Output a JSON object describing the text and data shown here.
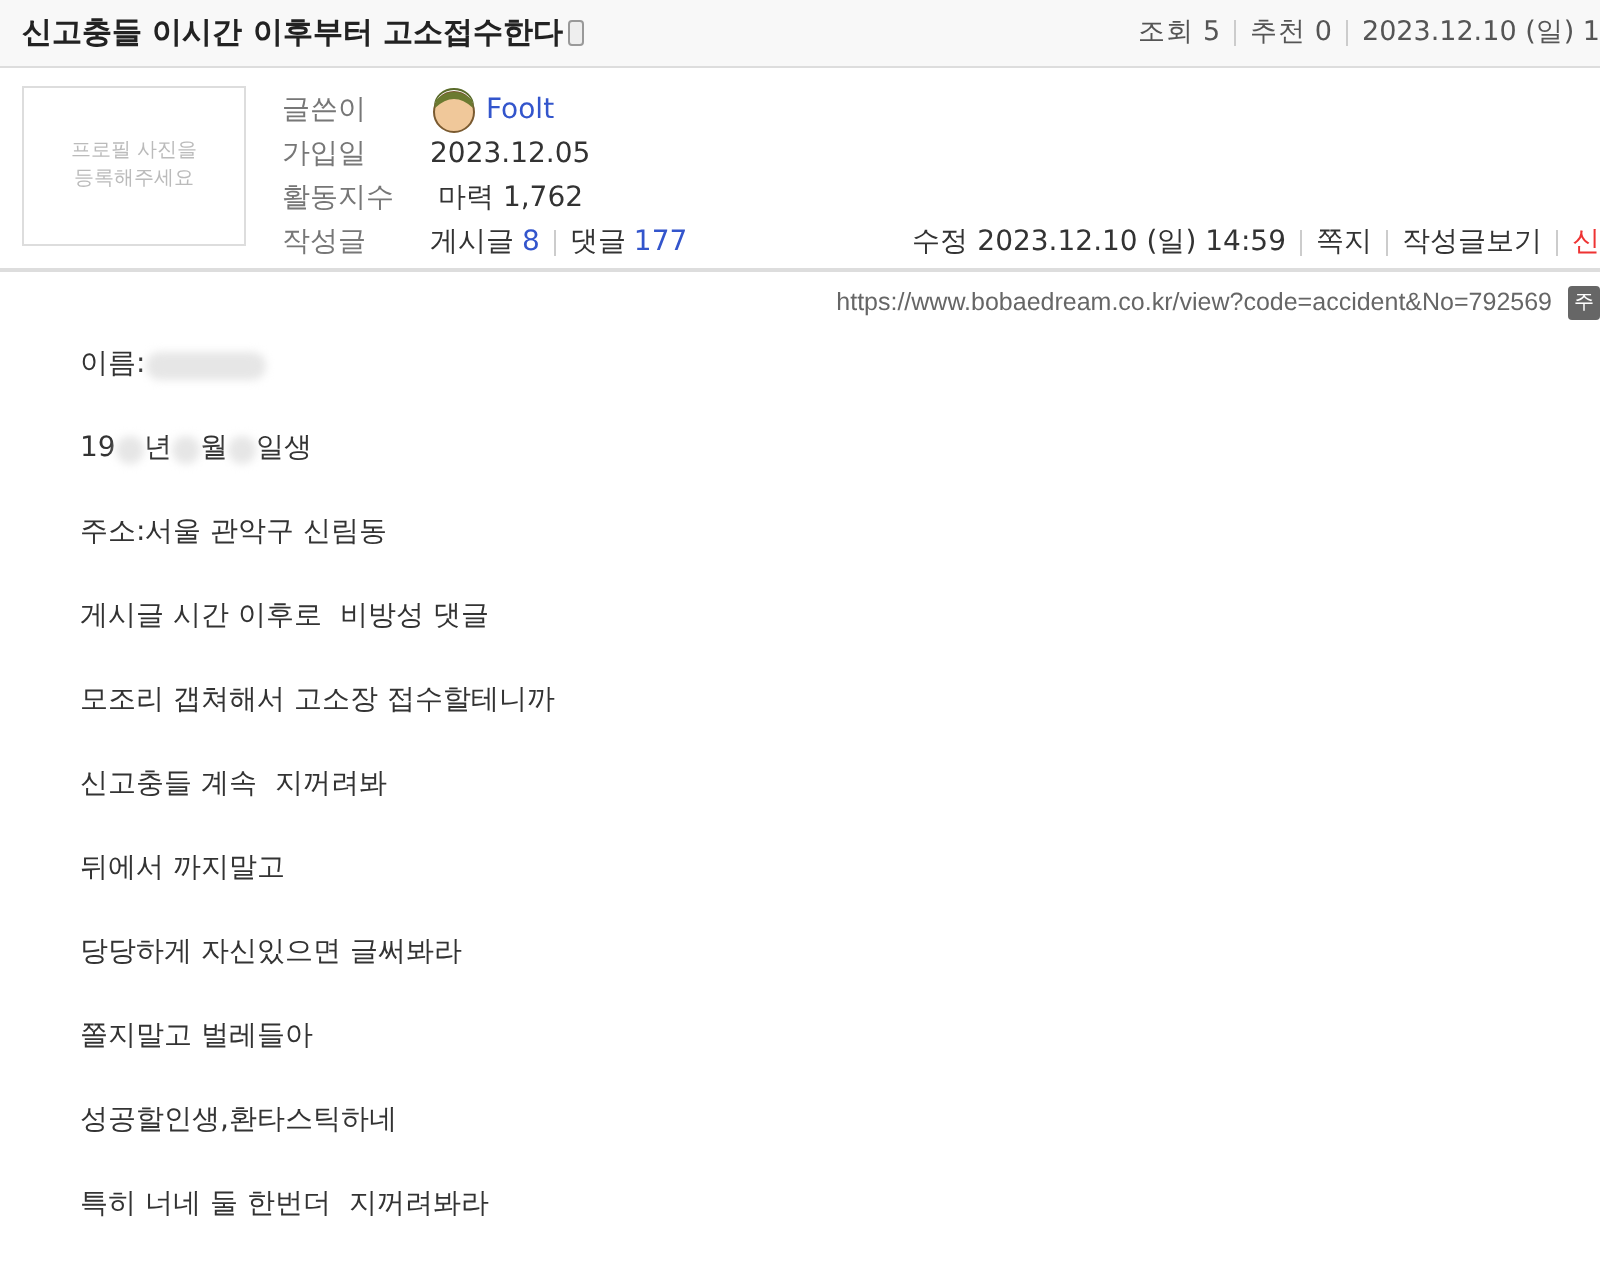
{
  "post": {
    "title": "신고충들 이시간 이후부터 고소접수한다",
    "stats": [
      "조회 5",
      "추천 0",
      "2023.12.10 (일) 1"
    ]
  },
  "profile": {
    "photo_placeholder": "프로필 사진을\n등록해주세요"
  },
  "info": [
    {
      "label": "글쓴이",
      "kind": "user",
      "value": "Foolt"
    },
    {
      "label": "가입일",
      "kind": "text",
      "value": "2023.12.05"
    },
    {
      "label": "활동지수",
      "kind": "text",
      "value": "마력 1,762"
    },
    {
      "label": "작성글",
      "kind": "counts",
      "items": [
        {
          "label": "게시글",
          "count": "8"
        },
        {
          "label": "댓글",
          "count": "177"
        }
      ]
    }
  ],
  "actions": [
    {
      "label": "수정 2023.12.10 (일) 14:59",
      "kind": "text"
    },
    {
      "label": "쪽지",
      "kind": "link"
    },
    {
      "label": "작성글보기",
      "kind": "link"
    },
    {
      "label": "신",
      "kind": "alert"
    }
  ],
  "url": {
    "text": "https://www.bobaedream.co.kr/view?code=accident&No=792569",
    "badge": "주"
  },
  "body": [
    [
      {
        "kind": "text",
        "text": "이름:"
      },
      {
        "kind": "redacted"
      }
    ],
    [
      {
        "kind": "text",
        "text": "19"
      },
      {
        "kind": "redacted"
      },
      {
        "kind": "text",
        "text": "년"
      },
      {
        "kind": "redacted"
      },
      {
        "kind": "text",
        "text": "월"
      },
      {
        "kind": "redacted"
      },
      {
        "kind": "text",
        "text": "일생"
      }
    ],
    [
      {
        "kind": "text",
        "text": "주소:서울 관악구 신림동"
      }
    ],
    [
      {
        "kind": "text",
        "text": "게시글 시간 이후로  비방성 댓글"
      }
    ],
    [
      {
        "kind": "text",
        "text": "모조리 갭쳐해서 고소장 접수할테니까"
      }
    ],
    [
      {
        "kind": "text",
        "text": "신고충들 계속  지꺼려봐"
      }
    ],
    [
      {
        "kind": "text",
        "text": "뒤에서 까지말고"
      }
    ],
    [
      {
        "kind": "text",
        "text": "당당하게 자신있으면 글써봐라"
      }
    ],
    [
      {
        "kind": "text",
        "text": "쫄지말고 벌레들아"
      }
    ],
    [
      {
        "kind": "text",
        "text": "성공할인생,환타스틱하네"
      }
    ],
    [
      {
        "kind": "text",
        "text": "특히 너네 둘 한번더  지꺼려봐라"
      }
    ]
  ]
}
